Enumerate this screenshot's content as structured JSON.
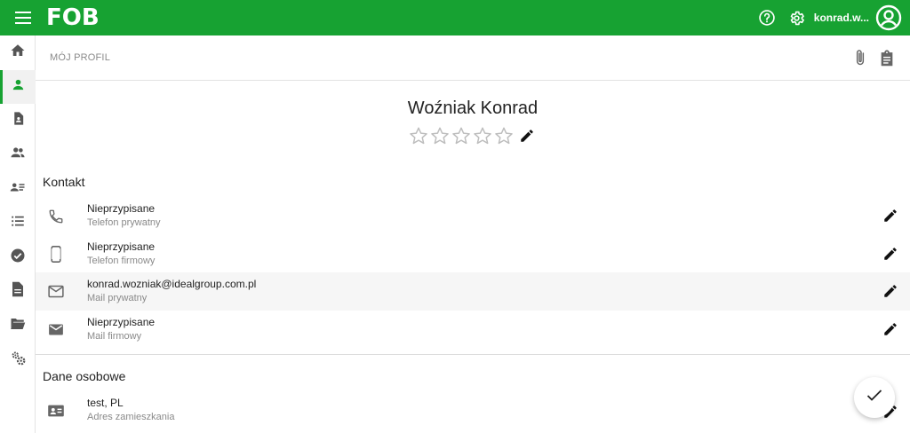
{
  "app": {
    "logo_text": "FOB",
    "brand_color": "#17a232"
  },
  "topbar": {
    "menu_icon": "hamburger-icon",
    "help_icon": "help-icon",
    "settings_icon": "gear-icon",
    "username": "konrad.w...",
    "avatar_icon": "account-circle-icon"
  },
  "sidebar": {
    "items": [
      {
        "icon": "home-icon",
        "active": false
      },
      {
        "icon": "person-icon",
        "active": true
      },
      {
        "icon": "contact-document-icon",
        "active": false
      },
      {
        "icon": "people-icon",
        "active": false
      },
      {
        "icon": "person-list-icon",
        "active": false
      },
      {
        "icon": "list-icon",
        "active": false
      },
      {
        "icon": "check-circle-icon",
        "active": false
      },
      {
        "icon": "document-icon",
        "active": false
      },
      {
        "icon": "folder-open-icon",
        "active": false
      },
      {
        "icon": "cogs-icon",
        "active": false
      }
    ]
  },
  "subheader": {
    "breadcrumb": "MÓJ PROFIL",
    "attach_icon": "paperclip-icon",
    "clipboard_icon": "clipboard-icon"
  },
  "profile": {
    "name": "Woźniak Konrad",
    "rating": 0,
    "rating_max": 5
  },
  "sections": {
    "contact": {
      "title": "Kontakt",
      "rows": [
        {
          "icon": "phone-icon",
          "value": "Nieprzypisane",
          "label": "Telefon prywatny"
        },
        {
          "icon": "smartphone-icon",
          "value": "Nieprzypisane",
          "label": "Telefon firmowy"
        },
        {
          "icon": "mail-outline-icon",
          "value": "konrad.wozniak@idealgroup.com.pl",
          "label": "Mail prywatny"
        },
        {
          "icon": "mail-icon",
          "value": "Nieprzypisane",
          "label": "Mail firmowy"
        }
      ]
    },
    "personal": {
      "title": "Dane osobowe",
      "rows": [
        {
          "icon": "id-card-icon",
          "value": "test, PL",
          "label": "Adres zamieszkania"
        }
      ]
    }
  },
  "fab": {
    "icon": "check-icon"
  }
}
